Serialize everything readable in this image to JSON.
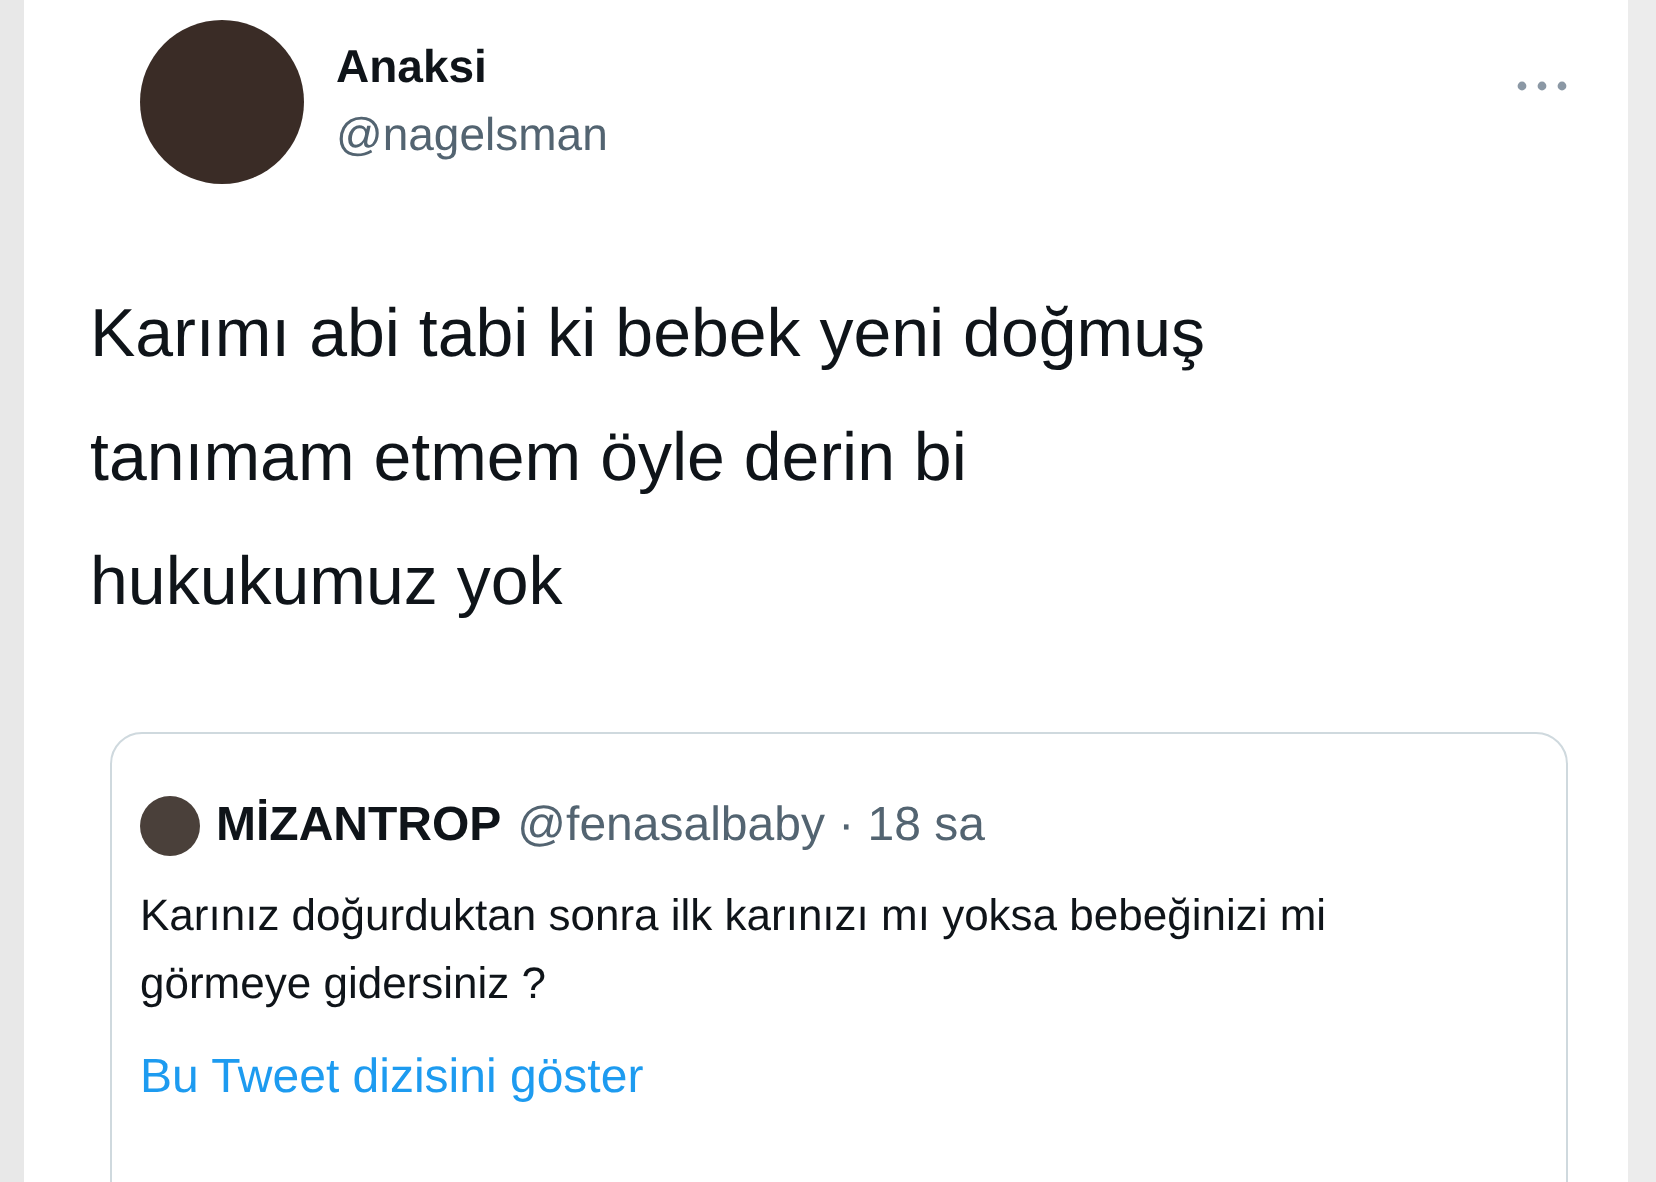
{
  "author": {
    "name": "Anaksi",
    "handle": "@nagelsman"
  },
  "tweet_text": "Karımı abi tabi ki bebek yeni doğmuş tanımam etmem öyle derin bi hukukumuz yok",
  "quoted_tweet": {
    "name": "MİZANTROP",
    "meta": "@fenasalbaby · 18 sa",
    "text": "Karınız doğurduktan sonra ilk karınızı mı yoksa bebeğinizi mi görmeye gidersiniz ?",
    "thread_link": "Bu Tweet dizisini göster"
  }
}
